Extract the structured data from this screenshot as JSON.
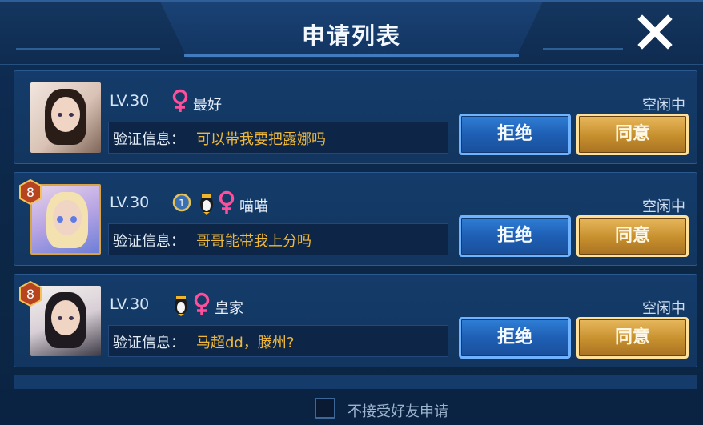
{
  "dialog": {
    "title": "申请列表",
    "close_icon": "close-icon"
  },
  "requests": [
    {
      "level": "LV.30",
      "gender_icon": "female-icon",
      "extra_badges": [],
      "nickname": "最好",
      "status": "空闲中",
      "message_label": "验证信息：",
      "message": "可以带我要把露娜吗",
      "reject_label": "拒绝",
      "accept_label": "同意",
      "avatar_level": ""
    },
    {
      "level": "LV.30",
      "gender_icon": "female-icon",
      "extra_badges": [
        "rank-badge-icon",
        "penguin-icon"
      ],
      "nickname": "喵喵",
      "status": "空闲中",
      "message_label": "验证信息：",
      "message": "哥哥能带我上分吗",
      "reject_label": "拒绝",
      "accept_label": "同意",
      "avatar_level": "8"
    },
    {
      "level": "LV.30",
      "gender_icon": "female-icon",
      "extra_badges": [
        "penguin-icon"
      ],
      "nickname": "皇家",
      "status": "空闲中",
      "message_label": "验证信息：",
      "message": "马超dd，滕州?",
      "reject_label": "拒绝",
      "accept_label": "同意",
      "avatar_level": "8"
    }
  ],
  "footer": {
    "checkbox_checked": false,
    "label": "不接受好友申请"
  },
  "colors": {
    "accent_gold": "#f0b93a",
    "female_pink": "#ff4f9a",
    "reject_blue": "#2f7fd6",
    "accept_gold": "#c68f2d"
  }
}
